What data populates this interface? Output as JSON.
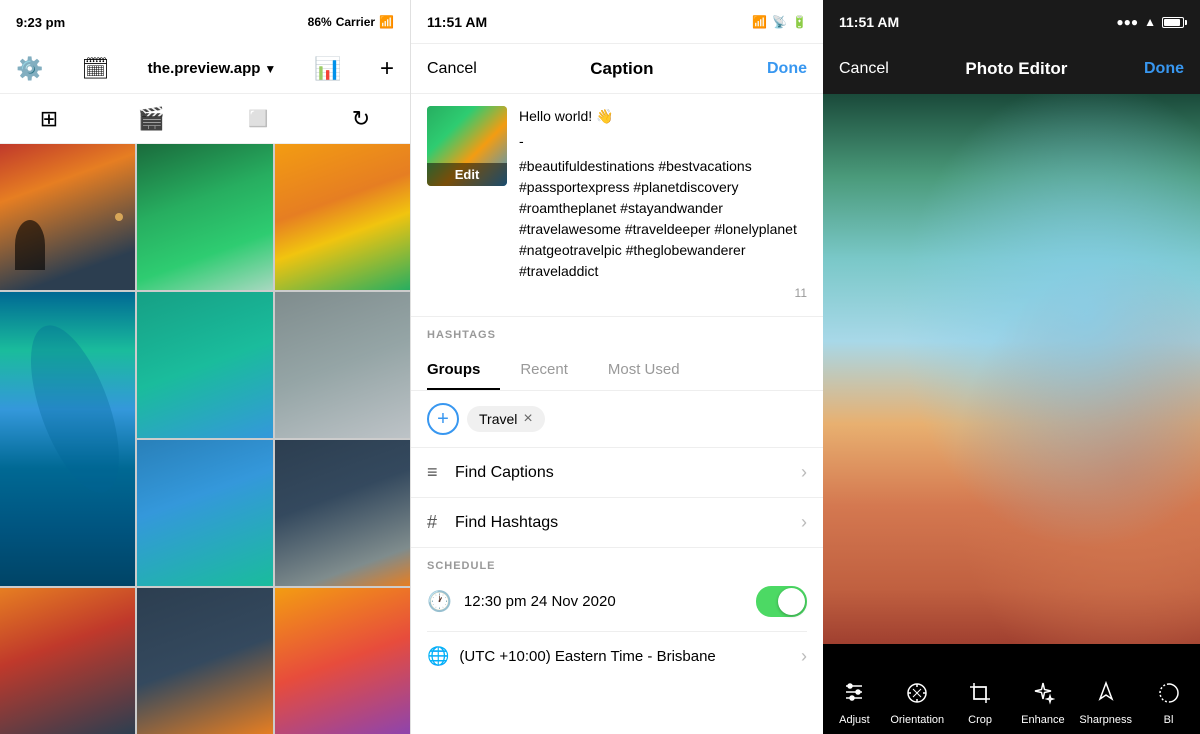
{
  "feed": {
    "status_time": "9:23 pm",
    "status_battery": "86%",
    "status_carrier": "Carrier",
    "account_name": "the.preview.app",
    "nav_icons": {
      "settings": "⚙",
      "calendar": "📅",
      "stats": "📊",
      "add": "+"
    },
    "toolbar_icons": [
      "grid",
      "reel",
      "stories",
      "refresh"
    ]
  },
  "caption_panel": {
    "status_time": "11:51 AM",
    "header": {
      "cancel_label": "Cancel",
      "title": "Caption",
      "done_label": "Done"
    },
    "thumb_edit_label": "Edit",
    "caption_greeting": "Hello world! 👋",
    "caption_dash": "-",
    "caption_hashtags": "#beautifuldestinations #bestvacations #passportexpress #planetdiscovery #roamtheplanet #stayandwander #travelawesome #traveldeeper #lonelyplanet #natgeotravelpic #theglobewanderer #traveladdict",
    "char_count": "11",
    "hashtags_label": "HASHTAGS",
    "tabs": [
      {
        "label": "Groups",
        "active": true
      },
      {
        "label": "Recent",
        "active": false
      },
      {
        "label": "Most Used",
        "active": false
      }
    ],
    "tag_chips": [
      "Travel"
    ],
    "find_captions_label": "Find Captions",
    "find_hashtags_label": "Find Hashtags",
    "schedule_label": "SCHEDULE",
    "schedule_time": "12:30 pm  24 Nov 2020",
    "timezone_label": "(UTC +10:00) Eastern Time - Brisbane"
  },
  "editor": {
    "status_time": "11:51 AM",
    "header": {
      "cancel_label": "Cancel",
      "title": "Photo Editor",
      "done_label": "Done"
    },
    "tools": [
      {
        "id": "adjust",
        "label": "Adjust",
        "icon": "adjust"
      },
      {
        "id": "orientation",
        "label": "Orientation",
        "icon": "orientation"
      },
      {
        "id": "crop",
        "label": "Crop",
        "icon": "crop"
      },
      {
        "id": "enhance",
        "label": "Enhance",
        "icon": "enhance"
      },
      {
        "id": "sharpness",
        "label": "Sharpness",
        "icon": "sharpness"
      },
      {
        "id": "bl",
        "label": "Bl",
        "icon": "bl"
      }
    ]
  }
}
